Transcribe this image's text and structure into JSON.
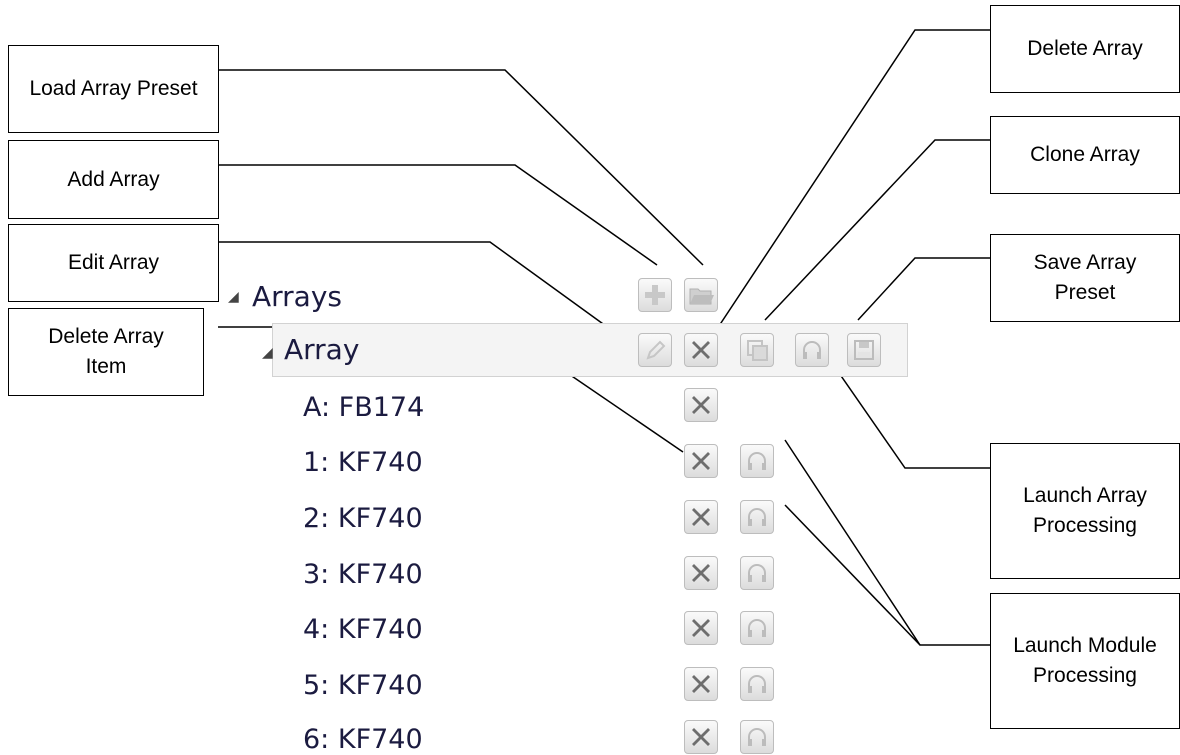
{
  "tree": {
    "root_label": "Arrays",
    "array_label": "Array",
    "items": [
      "A: FB174",
      "1: KF740",
      "2: KF740",
      "3: KF740",
      "4: KF740",
      "5: KF740",
      "6: KF740"
    ]
  },
  "callouts": {
    "load_array_preset": "Load Array Preset",
    "add_array": "Add Array",
    "edit_array": "Edit Array",
    "delete_array_item": "Delete Array Item",
    "delete_array": "Delete Array",
    "clone_array": "Clone Array",
    "save_array_preset": "Save Array Preset",
    "launch_array_processing": "Launch Array Processing",
    "launch_module_processing": "Launch Module Processing"
  },
  "icons": {
    "add": "plus-icon",
    "load": "folder-open-icon",
    "edit": "pencil-icon",
    "delete": "x-icon",
    "clone": "clone-icon",
    "launch": "headphones-icon",
    "save": "floppy-disk-icon"
  },
  "colors": {
    "tree_text": "#1b1b40",
    "icon_glyph": "#6e6e6e",
    "icon_glyph_disabled": "#c4c4c4",
    "row_highlight": "#f4f4f4"
  }
}
